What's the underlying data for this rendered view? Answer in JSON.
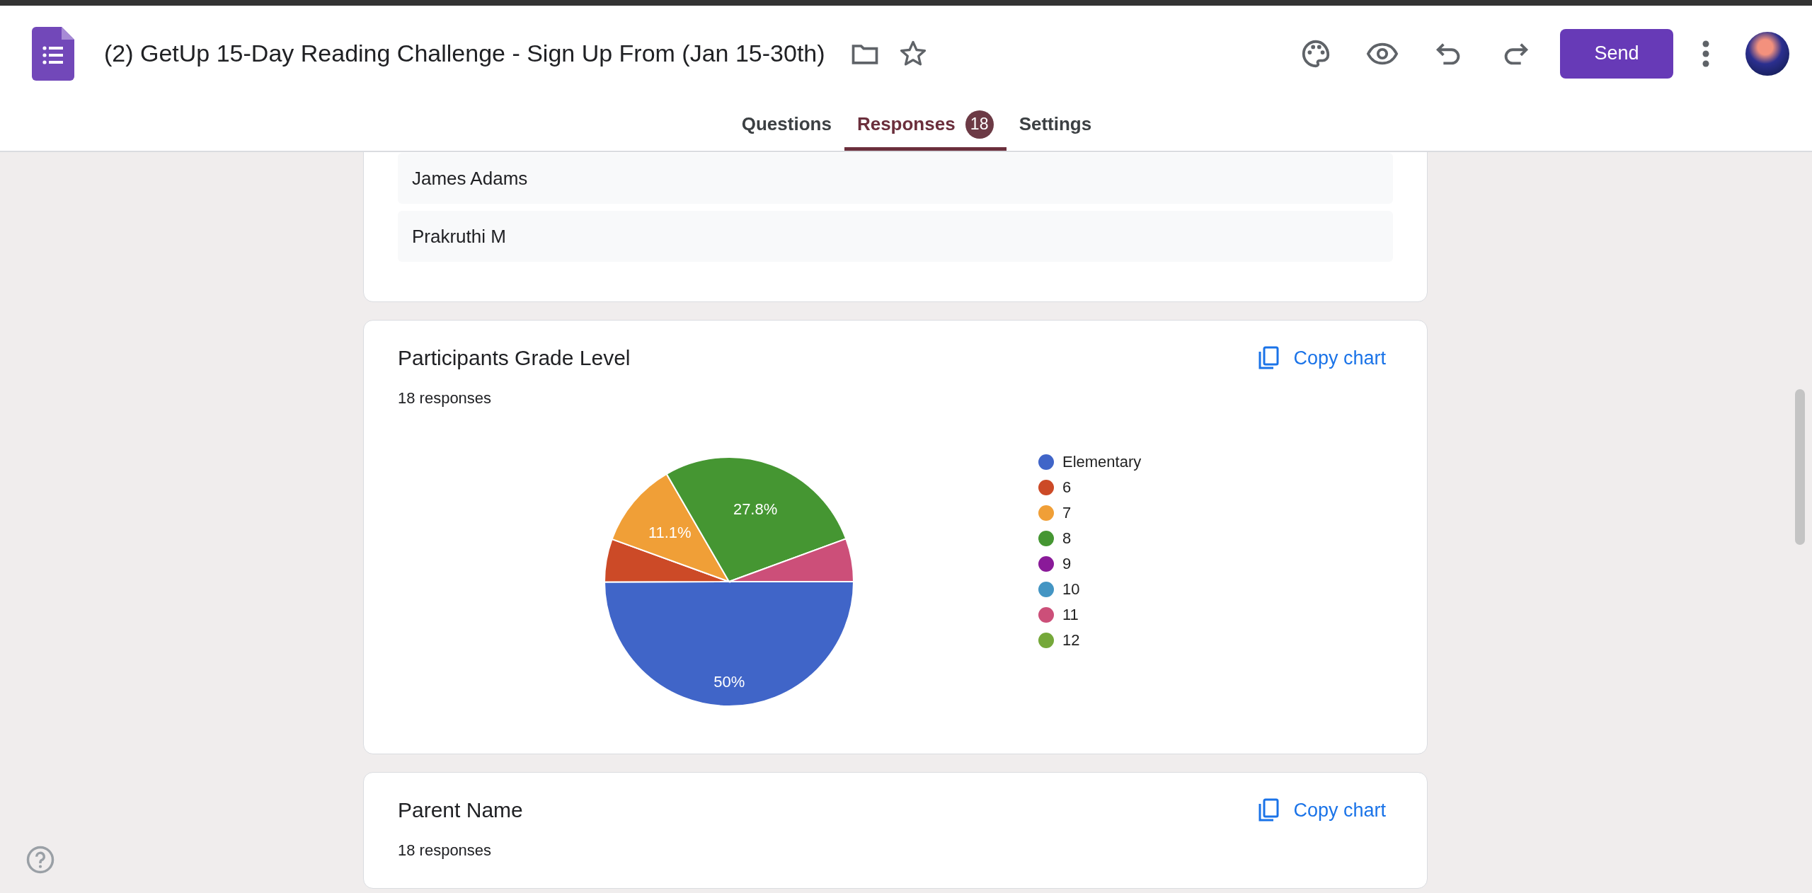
{
  "app": {
    "title": "(2) GetUp 15-Day Reading Challenge - Sign Up From (Jan 15-30th)",
    "send_button": "Send",
    "tabs": [
      {
        "label": "Questions",
        "selected": false
      },
      {
        "label": "Responses",
        "selected": true,
        "badge": "18"
      },
      {
        "label": "Settings",
        "selected": false
      }
    ]
  },
  "name_list": [
    "James Adams",
    "Prakruthi M"
  ],
  "questions": [
    {
      "title": "Participants Grade Level",
      "copy_label": "Copy chart",
      "count": "18 responses",
      "chart_data": {
        "type": "pie",
        "categories": [
          "Elementary",
          "6",
          "7",
          "8",
          "9",
          "10",
          "11",
          "12"
        ],
        "values": [
          50,
          5.6,
          11.1,
          27.8,
          0,
          0,
          5.6,
          0
        ],
        "colors": [
          "#4065c8",
          "#cc4a27",
          "#f09f37",
          "#459632",
          "#8a1a99",
          "#4395c3",
          "#cc4f79",
          "#75a83a"
        ],
        "value_labels": [
          "50%",
          null,
          "11.1%",
          "27.8%",
          null,
          null,
          null,
          null
        ]
      }
    },
    {
      "title": "Parent Name",
      "copy_label": "Copy chart",
      "count": "18 responses"
    }
  ]
}
